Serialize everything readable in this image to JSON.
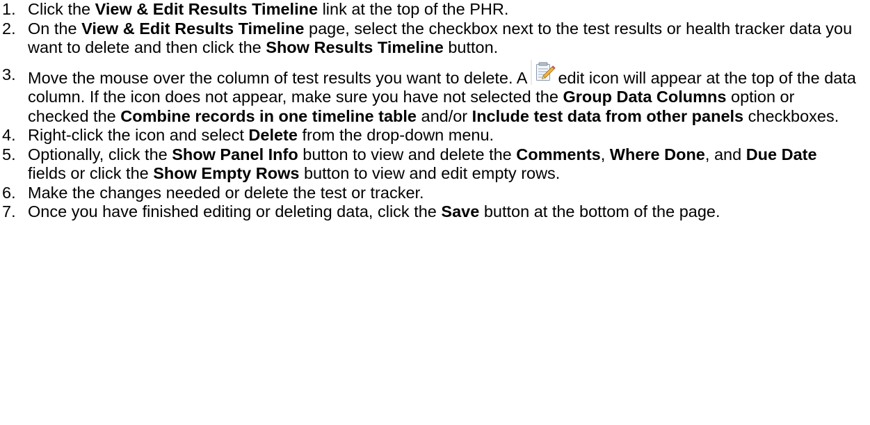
{
  "steps": [
    {
      "num": "1.",
      "t1": "Click the ",
      "b1": "View & Edit Results Timeline",
      "t2": " link at the top of the PHR."
    },
    {
      "num": "2.",
      "t1": "On the ",
      "b1": "View & Edit Results Timeline",
      "t2": " page, select the checkbox next to the test results or health tracker data you want to delete and then click the ",
      "b2": "Show Results Timeline",
      "t3": " button."
    },
    {
      "num": "3.",
      "t1": "Move the mouse over the column of test results you want to delete. A",
      "t2": "edit icon will appear at the top of the data column. If the icon does not appear, make sure you have not selected the ",
      "b1": "Group Data Columns",
      "t3": " option or checked the ",
      "b2": "Combine records in one timeline table",
      "t4": " and/or ",
      "b3": "Include test data from other panels",
      "t5": " checkboxes.",
      "icon": "edit-icon"
    },
    {
      "num": "4.",
      "t1": "Right-click the icon and select ",
      "b1": "Delete",
      "t2": " from the drop-down menu."
    },
    {
      "num": "5.",
      "t1": "Optionally, click the ",
      "b1": "Show Panel Info",
      "t2": " button to view and delete the ",
      "b2": "Comments",
      "t3": ", ",
      "b3": "Where Done",
      "t4": ", and ",
      "b4": "Due Date",
      "t5": " fields or click the ",
      "b5": "Show Empty Rows",
      "t6": " button to view and edit empty rows."
    },
    {
      "num": "6.",
      "t1": "Make the changes needed or delete the test or tracker."
    },
    {
      "num": "7.",
      "t1": "Once you have finished editing or deleting data, click the ",
      "b1": "Save",
      "t2": " button at the bottom of the page."
    }
  ]
}
